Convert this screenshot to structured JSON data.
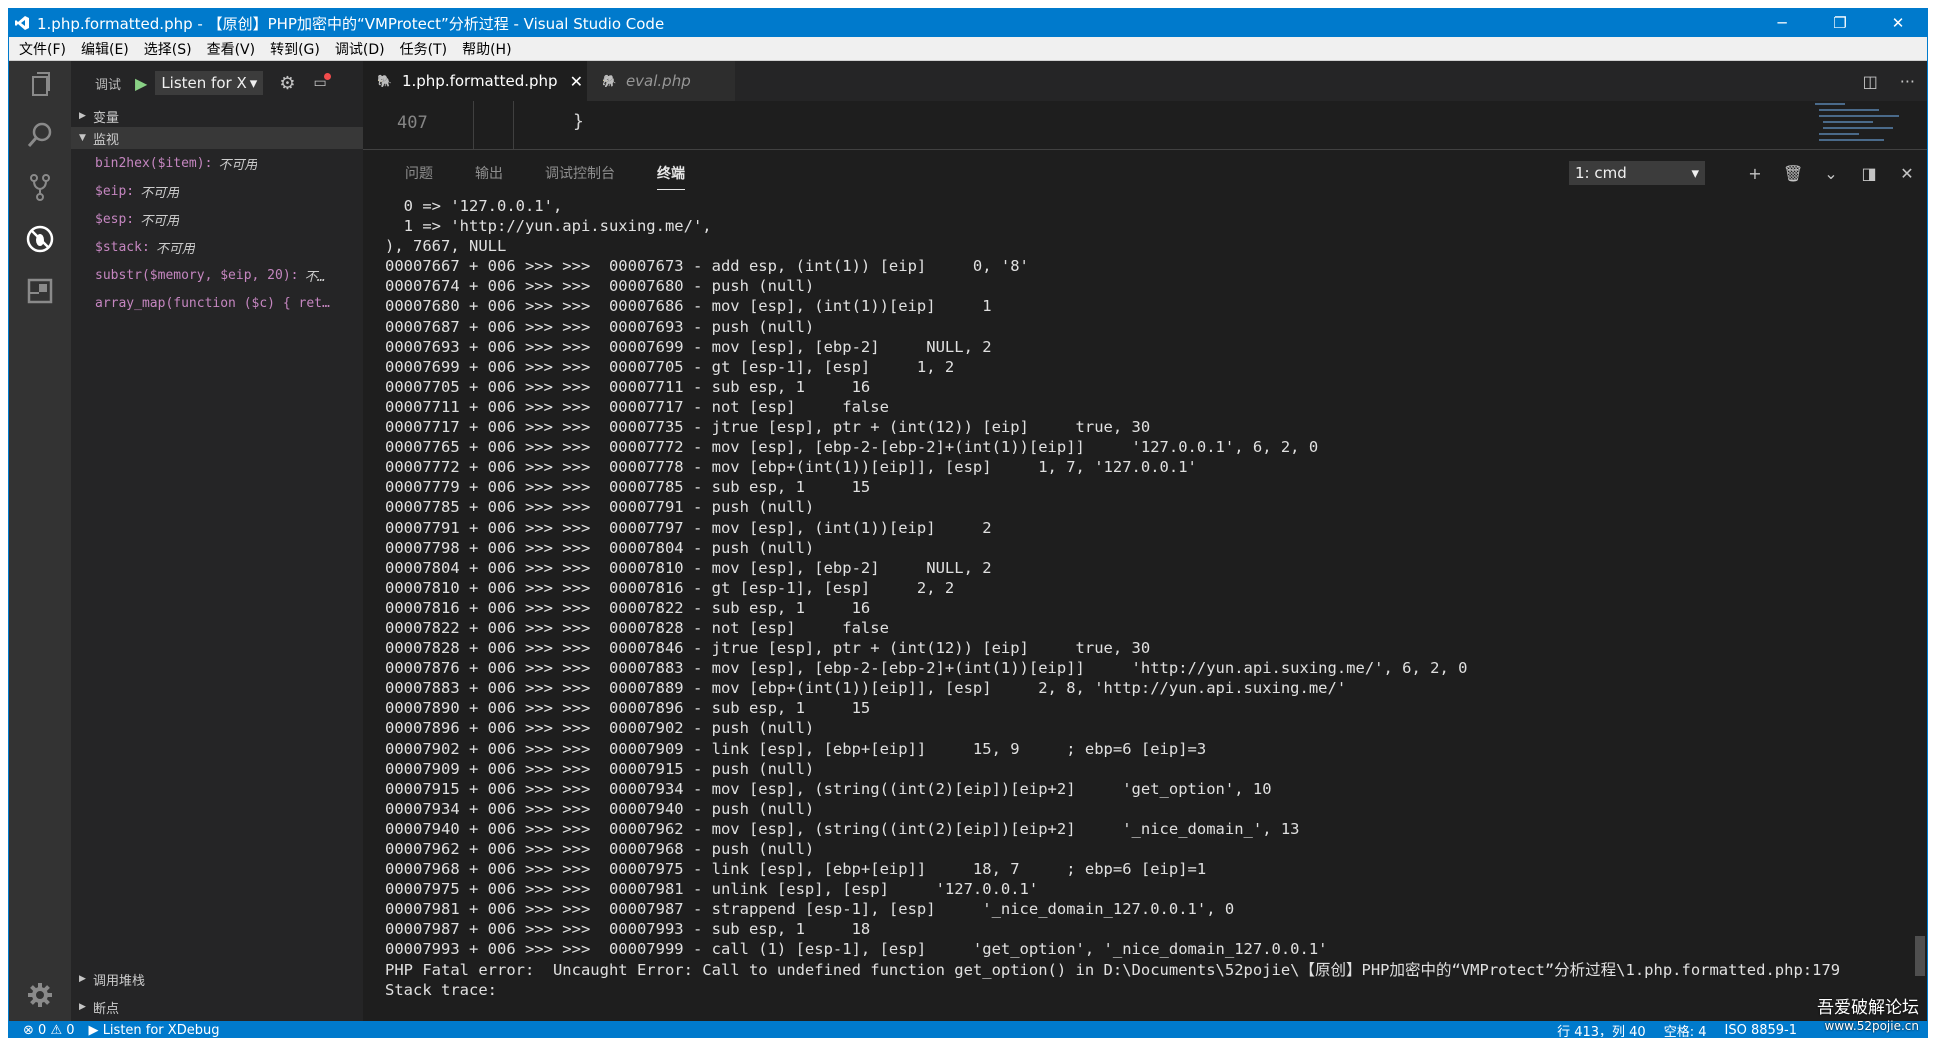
{
  "window": {
    "title": "1.php.formatted.php - 【原创】PHP加密中的“VMProtect”分析过程 - Visual Studio Code",
    "controls": {
      "minimize": "─",
      "restore": "❐",
      "close": "✕"
    }
  },
  "menu": [
    "文件(F)",
    "编辑(E)",
    "选择(S)",
    "查看(V)",
    "转到(G)",
    "调试(D)",
    "任务(T)",
    "帮助(H)"
  ],
  "activity_icons": [
    "files-icon",
    "search-icon",
    "source-control-icon",
    "debug-icon",
    "extensions-icon",
    "gear-icon"
  ],
  "debug_toolbar": {
    "title": "调试",
    "config": "Listen for X",
    "dropdown_arrow": "▾"
  },
  "sidebar": {
    "variables_header": "变量",
    "watch_header": "监视",
    "watch": [
      {
        "expr": "bin2hex($item):",
        "value": "不可用"
      },
      {
        "expr": "$eip:",
        "value": "不可用"
      },
      {
        "expr": "$esp:",
        "value": "不可用"
      },
      {
        "expr": "$stack:",
        "value": "不可用"
      },
      {
        "expr": "substr($memory, $eip, 20):",
        "value": "不…"
      },
      {
        "expr": "array_map(function ($c) { ret…",
        "value": ""
      }
    ],
    "callstack_header": "调用堆栈",
    "breakpoints_header": "断点"
  },
  "tabs": [
    {
      "label": "1.php.formatted.php",
      "active": true
    },
    {
      "label": "eval.php",
      "active": false
    }
  ],
  "editor": {
    "line_number": "407",
    "code": "}"
  },
  "panel": {
    "tabs": [
      "问题",
      "输出",
      "调试控制台",
      "终端"
    ],
    "active_tab": "终端",
    "terminal_select": "1: cmd",
    "terminal_lines": [
      "  0 => '127.0.0.1',",
      "  1 => 'http://yun.api.suxing.me/',",
      "), 7667, NULL",
      "00007667 + 006 >>> >>>  00007673 - add esp, (int(1)) [eip]     0, '8'",
      "00007674 + 006 >>> >>>  00007680 - push (null)",
      "00007680 + 006 >>> >>>  00007686 - mov [esp], (int(1))[eip]     1",
      "00007687 + 006 >>> >>>  00007693 - push (null)",
      "00007693 + 006 >>> >>>  00007699 - mov [esp], [ebp-2]     NULL, 2",
      "00007699 + 006 >>> >>>  00007705 - gt [esp-1], [esp]     1, 2",
      "00007705 + 006 >>> >>>  00007711 - sub esp, 1     16",
      "00007711 + 006 >>> >>>  00007717 - not [esp]     false",
      "00007717 + 006 >>> >>>  00007735 - jtrue [esp], ptr + (int(12)) [eip]     true, 30",
      "00007765 + 006 >>> >>>  00007772 - mov [esp], [ebp-2-[ebp-2]+(int(1))[eip]]     '127.0.0.1', 6, 2, 0",
      "00007772 + 006 >>> >>>  00007778 - mov [ebp+(int(1))[eip]], [esp]     1, 7, '127.0.0.1'",
      "00007779 + 006 >>> >>>  00007785 - sub esp, 1     15",
      "00007785 + 006 >>> >>>  00007791 - push (null)",
      "00007791 + 006 >>> >>>  00007797 - mov [esp], (int(1))[eip]     2",
      "00007798 + 006 >>> >>>  00007804 - push (null)",
      "00007804 + 006 >>> >>>  00007810 - mov [esp], [ebp-2]     NULL, 2",
      "00007810 + 006 >>> >>>  00007816 - gt [esp-1], [esp]     2, 2",
      "00007816 + 006 >>> >>>  00007822 - sub esp, 1     16",
      "00007822 + 006 >>> >>>  00007828 - not [esp]     false",
      "00007828 + 006 >>> >>>  00007846 - jtrue [esp], ptr + (int(12)) [eip]     true, 30",
      "00007876 + 006 >>> >>>  00007883 - mov [esp], [ebp-2-[ebp-2]+(int(1))[eip]]     'http://yun.api.suxing.me/', 6, 2, 0",
      "00007883 + 006 >>> >>>  00007889 - mov [ebp+(int(1))[eip]], [esp]     2, 8, 'http://yun.api.suxing.me/'",
      "00007890 + 006 >>> >>>  00007896 - sub esp, 1     15",
      "00007896 + 006 >>> >>>  00007902 - push (null)",
      "00007902 + 006 >>> >>>  00007909 - link [esp], [ebp+[eip]]     15, 9     ; ebp=6 [eip]=3",
      "00007909 + 006 >>> >>>  00007915 - push (null)",
      "00007915 + 006 >>> >>>  00007934 - mov [esp], (string((int(2)[eip])[eip+2]     'get_option', 10",
      "00007934 + 006 >>> >>>  00007940 - push (null)",
      "00007940 + 006 >>> >>>  00007962 - mov [esp], (string((int(2)[eip])[eip+2]     '_nice_domain_', 13",
      "00007962 + 006 >>> >>>  00007968 - push (null)",
      "00007968 + 006 >>> >>>  00007975 - link [esp], [ebp+[eip]]     18, 7     ; ebp=6 [eip]=1",
      "00007975 + 006 >>> >>>  00007981 - unlink [esp], [esp]     '127.0.0.1'",
      "00007981 + 006 >>> >>>  00007987 - strappend [esp-1], [esp]     '_nice_domain_127.0.0.1', 0",
      "00007987 + 006 >>> >>>  00007993 - sub esp, 1     18",
      "00007993 + 006 >>> >>>  00007999 - call (1) [esp-1], [esp]     'get_option', '_nice_domain_127.0.0.1'",
      "PHP Fatal error:  Uncaught Error: Call to undefined function get_option() in D:\\Documents\\52pojie\\【原创】PHP加密中的“VMProtect”分析过程\\1.php.formatted.php:179",
      "Stack trace:"
    ]
  },
  "statusbar": {
    "errors": "0",
    "warnings": "0",
    "debug_config": "Listen for XDebug",
    "position": "行 413，列 40",
    "spaces": "空格: 4",
    "encoding": "ISO 8859-1"
  },
  "watermark": {
    "title": "吾爱破解论坛",
    "url": "www.52pojie.cn"
  },
  "colors": {
    "accent": "#007acc",
    "activity_bar": "#333333",
    "sidebar": "#252526",
    "editor": "#1e1e1e",
    "watch_expr": "#c586c0"
  }
}
